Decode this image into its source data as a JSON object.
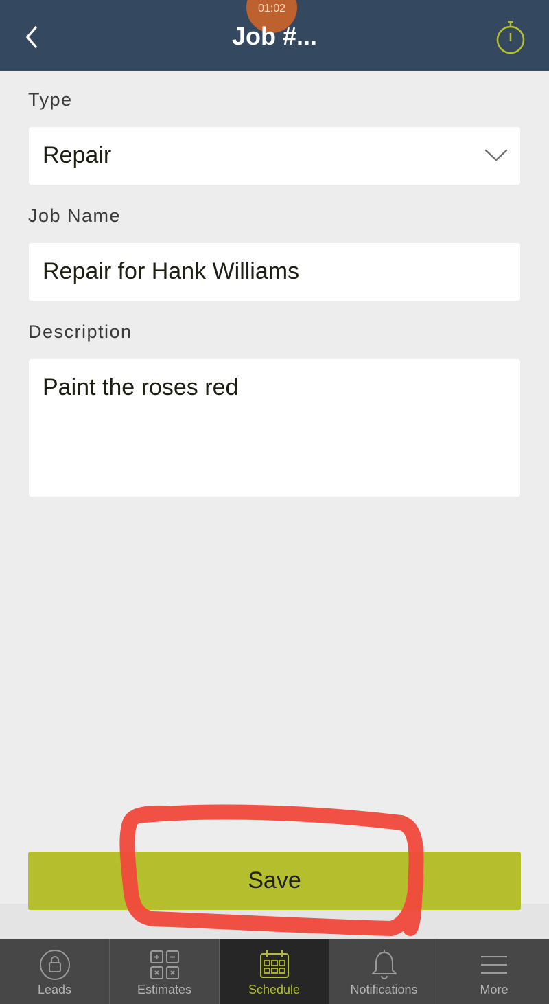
{
  "header": {
    "title": "Job #...",
    "timer_text": "01:02",
    "back_icon": "chevron-left-icon",
    "stopwatch_icon": "stopwatch-icon"
  },
  "form": {
    "type": {
      "label": "Type",
      "value": "Repair",
      "icon": "chevron-down-icon"
    },
    "job_name": {
      "label": "Job Name",
      "value": "Repair for Hank Williams"
    },
    "description": {
      "label": "Description",
      "value": "Paint the roses red"
    }
  },
  "save_label": "Save",
  "tabs": [
    {
      "label": "Leads",
      "icon": "lock-icon",
      "active": false
    },
    {
      "label": "Estimates",
      "icon": "calculator-icon",
      "active": false
    },
    {
      "label": "Schedule",
      "icon": "calendar-icon",
      "active": true
    },
    {
      "label": "Notifications",
      "icon": "bell-icon",
      "active": false
    },
    {
      "label": "More",
      "icon": "menu-icon",
      "active": false
    }
  ],
  "colors": {
    "header": "#34485f",
    "accent": "#b5bf2e",
    "tabbar": "#474747",
    "annotation": "#f04a3c"
  }
}
